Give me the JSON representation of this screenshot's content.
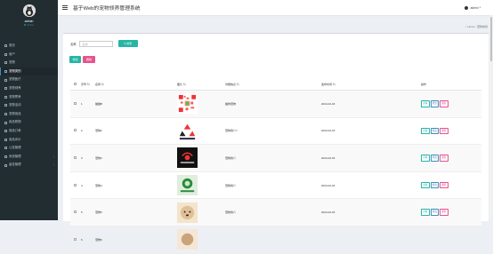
{
  "user": {
    "name": "admin",
    "status": "Online"
  },
  "sidebar": {
    "items": [
      {
        "label": "首页",
        "active": false
      },
      {
        "label": "用户",
        "active": false
      },
      {
        "label": "宠物",
        "active": false
      },
      {
        "label": "宠物类别",
        "active": true
      },
      {
        "label": "宠物医疗",
        "active": false
      },
      {
        "label": "宠物领养",
        "active": false
      },
      {
        "label": "宠物寄养",
        "active": false
      },
      {
        "label": "宠物活动",
        "active": false
      },
      {
        "label": "宠物用品",
        "active": false
      },
      {
        "label": "用品购物",
        "active": false
      },
      {
        "label": "用品订单",
        "active": false
      },
      {
        "label": "用品评价",
        "active": false
      },
      {
        "label": "公告管理",
        "active": false
      },
      {
        "label": "系统管理",
        "active": false,
        "caret": "‹"
      },
      {
        "label": "留言管理",
        "active": false,
        "caret": "‹"
      }
    ]
  },
  "header": {
    "title": "基于Web的宠物领养管理系统",
    "user": "admin",
    "user_caret": "▾"
  },
  "breadcrumb": "⌂ Home  ›  宠物类别",
  "search": {
    "label": "名称",
    "placeholder": "名称",
    "button": "⚲ 搜索"
  },
  "toolbar": {
    "add": "增加",
    "delete": "删除"
  },
  "table": {
    "headers": [
      "序号 ⇅",
      "名称 ⇅",
      "图片 ⇅",
      "详细信息 ⇅",
      "发布时间 ⇅",
      "操作"
    ],
    "rows": [
      {
        "idx": "1",
        "name": "猫猫B",
        "desc": "猫狗宠物",
        "time": "2024-02-18",
        "thumb": "qr"
      },
      {
        "idx": "2",
        "name": "宠物2",
        "desc": "宠物简介7",
        "time": "2024-02-18",
        "thumb": "recycle"
      },
      {
        "idx": "3",
        "name": "宠物3",
        "desc": "宠物简介",
        "time": "2024-02-18",
        "thumb": "logo"
      },
      {
        "idx": "4",
        "name": "宠物4",
        "desc": "宠物简介",
        "time": "2024-02-18",
        "thumb": "green"
      },
      {
        "idx": "5",
        "name": "宠物5",
        "desc": "宠物简介",
        "time": "2024-02-18",
        "thumb": "dog"
      },
      {
        "idx": "6",
        "name": "宠物6",
        "desc": "",
        "time": "",
        "thumb": "tan"
      }
    ],
    "ops": {
      "view": "详情",
      "edit": "修改",
      "del": "删除"
    }
  },
  "colors": {
    "sidebar": "#222d32",
    "teal": "#26b5a4",
    "pink": "#e8528e",
    "blue": "#3c8dbc"
  }
}
